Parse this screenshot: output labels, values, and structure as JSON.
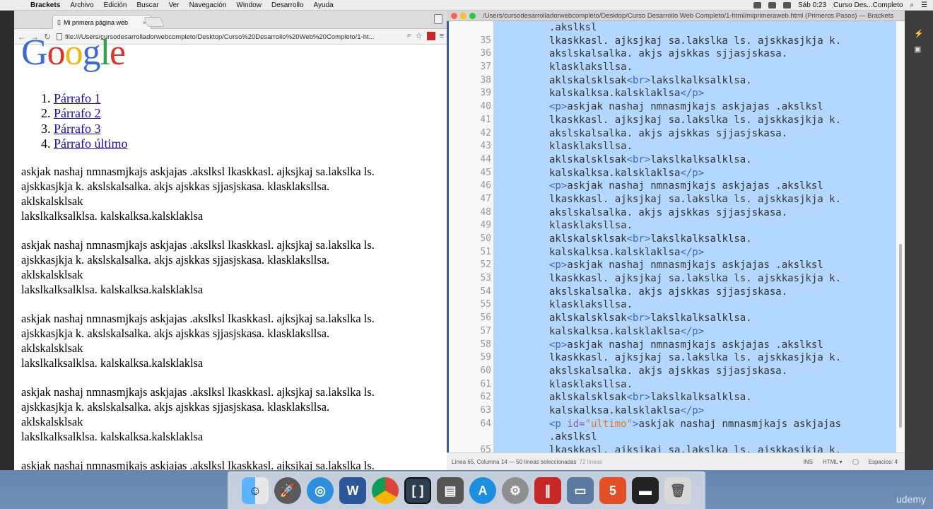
{
  "menubar": {
    "app": "Brackets",
    "items": [
      "Archivo",
      "Edición",
      "Buscar",
      "Ver",
      "Navegación",
      "Window",
      "Desarrollo",
      "Ayuda"
    ],
    "clock": "Sáb 0:23",
    "user": "Curso Des...Completo"
  },
  "browser": {
    "tab_title": "Mi primera página web",
    "url": "file:///Users/cursodesarrolladorwebcompleto/Desktop/Curso%20Desarrollo%20Web%20Completo/1-ht...",
    "logo_letters": [
      "G",
      "o",
      "o",
      "g",
      "l",
      "e"
    ],
    "links": [
      "Párrafo 1",
      "Párrafo 2",
      "Párrafo 3",
      "Párrafo último"
    ],
    "paragraph": {
      "l1": "askjak nashaj nmnasmjkajs askjajas .akslksl lkaskkasl. ajksjkaj sa.lakslka ls.",
      "l2": "ajskkasjkja k. akslskalsalka. akjs ajskkas sjjasjskasa. klasklaksllsa.",
      "l3": "aklskalsklsak",
      "l4": "lakslkalksalklsa. kalskalksa.kalsklaklsa"
    }
  },
  "editor": {
    "title": "/Users/cursodesarrolladorwebcompleto/Desktop/Curso Desarrollo Web Completo/1-html/miprimeraweb.html (Primeros Pasos) — Brackets",
    "lines": [
      {
        "n": "",
        "t": ".akslksl"
      },
      {
        "n": "35",
        "t": "lkaskkasl. ajksjkaj sa.lakslka ls. ajskkasjkja k."
      },
      {
        "n": "36",
        "t": "akslskalsalka. akjs ajskkas sjjasjskasa."
      },
      {
        "n": "37",
        "t": "klasklaksllsa."
      },
      {
        "n": "38",
        "t": "aklskalsklsak<br>lakslkalksalklsa."
      },
      {
        "n": "39",
        "t": "kalskalksa.kalsklaklsa</p>"
      },
      {
        "n": "40",
        "t": "<p>askjak nashaj nmnasmjkajs askjajas .akslksl"
      },
      {
        "n": "41",
        "t": "lkaskkasl. ajksjkaj sa.lakslka ls. ajskkasjkja k."
      },
      {
        "n": "42",
        "t": "akslskalsalka. akjs ajskkas sjjasjskasa."
      },
      {
        "n": "43",
        "t": "klasklaksllsa."
      },
      {
        "n": "44",
        "t": "aklskalsklsak<br>lakslkalksalklsa."
      },
      {
        "n": "45",
        "t": "kalskalksa.kalsklaklsa</p>"
      },
      {
        "n": "46",
        "t": "<p>askjak nashaj nmnasmjkajs askjajas .akslksl"
      },
      {
        "n": "47",
        "t": "lkaskkasl. ajksjkaj sa.lakslka ls. ajskkasjkja k."
      },
      {
        "n": "48",
        "t": "akslskalsalka. akjs ajskkas sjjasjskasa."
      },
      {
        "n": "49",
        "t": "klasklaksllsa."
      },
      {
        "n": "50",
        "t": "aklskalsklsak<br>lakslkalksalklsa."
      },
      {
        "n": "51",
        "t": "kalskalksa.kalsklaklsa</p>"
      },
      {
        "n": "52",
        "t": "<p>askjak nashaj nmnasmjkajs askjajas .akslksl"
      },
      {
        "n": "53",
        "t": "lkaskkasl. ajksjkaj sa.lakslka ls. ajskkasjkja k."
      },
      {
        "n": "54",
        "t": "akslskalsalka. akjs ajskkas sjjasjskasa."
      },
      {
        "n": "55",
        "t": "klasklaksllsa."
      },
      {
        "n": "56",
        "t": "aklskalsklsak<br>lakslkalksalklsa."
      },
      {
        "n": "57",
        "t": "kalskalksa.kalsklaklsa</p>"
      },
      {
        "n": "58",
        "t": "<p>askjak nashaj nmnasmjkajs askjajas .akslksl"
      },
      {
        "n": "59",
        "t": "lkaskkasl. ajksjkaj sa.lakslka ls. ajskkasjkja k."
      },
      {
        "n": "60",
        "t": "akslskalsalka. akjs ajskkas sjjasjskasa."
      },
      {
        "n": "61",
        "t": "klasklaksllsa."
      },
      {
        "n": "62",
        "t": "aklskalsklsak<br>lakslkalksalklsa."
      },
      {
        "n": "63",
        "t": "kalskalksa.kalsklaklsa</p>"
      },
      {
        "n": "64",
        "t": "<p id=\"ultimo\">askjak nashaj nmnasmjkajs askjajas"
      },
      {
        "n": "",
        "t": ".akslksl"
      },
      {
        "n": "65",
        "t": "lkaskkasl. ajksjkaj sa.lakslka ls. ajskkasjkja k."
      }
    ],
    "fold_lines": [
      "40",
      "46",
      "52",
      "58",
      "64"
    ],
    "status": {
      "position": "Línea 65, Columna 14 — 50 líneas seleccionadas",
      "count": "72 líneas",
      "ins": "INS",
      "lang": "HTML",
      "spaces": "Espacios: 4"
    }
  },
  "dock": [
    "Finder",
    "Launchpad",
    "Safari",
    "Word",
    "Chrome",
    "Brackets",
    "Photo",
    "App Store",
    "Preferencias",
    "FM",
    "Preview",
    "HTML5",
    "Terminal",
    "Papelera"
  ],
  "watermark": "udemy"
}
